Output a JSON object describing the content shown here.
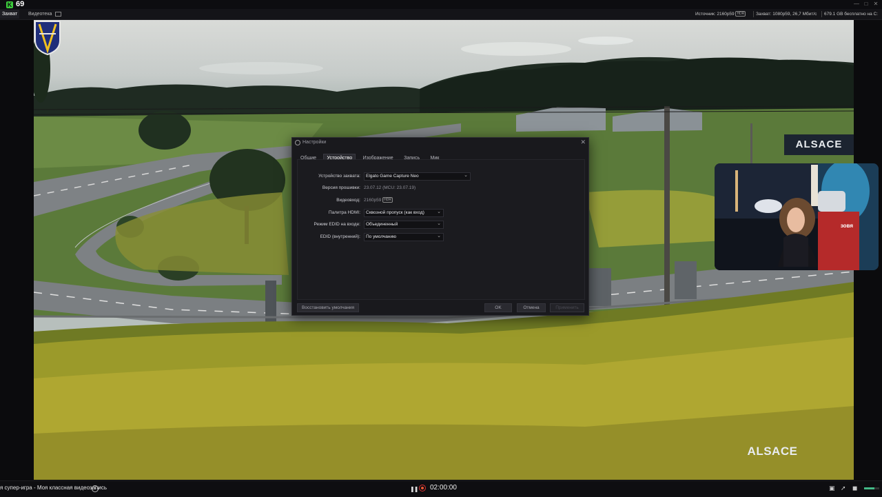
{
  "app": {
    "logo_letter": "K",
    "fps": "69"
  },
  "tabs": [
    {
      "label": "Захват"
    },
    {
      "label": "Видеотека"
    }
  ],
  "status": {
    "source": "Источник: 2160p59",
    "source_badge": "HDR",
    "capture": "Захват: 1080p59, 26,7 Мбит/с",
    "free": "679.1 GB бесплатно на C:"
  },
  "scene": {
    "sign_text": "ALSACE",
    "crest_text": "ALSACE"
  },
  "webcam": {
    "overlay_text": "зовя"
  },
  "dialog": {
    "title": "Настройки",
    "tabs": [
      {
        "label": "Общие",
        "active": false
      },
      {
        "label": "Устройство",
        "active": true
      },
      {
        "label": "Изображение",
        "active": false
      },
      {
        "label": "Запись",
        "active": false
      },
      {
        "label": "Мик",
        "active": false
      }
    ],
    "fields": {
      "device_label": "Устройство захвата:",
      "device_value": "Elgato Game Capture Neo",
      "firmware_label": "Версия прошивки:",
      "firmware_value": "23.07.12 (MCU: 23.07.19)",
      "video_in_label": "Видеовход:",
      "video_in_value": "2160p59",
      "video_in_badge": "HDR",
      "hdmi_label": "Палитра HDMI:",
      "hdmi_value": "Сквозной пропуск (как вход)",
      "edid_mode_label": "Режим EDID на входе:",
      "edid_mode_value": "Объединенный",
      "edid_internal_label": "EDID (внутренний):",
      "edid_internal_value": "По умолчанию"
    },
    "buttons": {
      "restore": "Восстановить умолчания",
      "ok": "OK",
      "cancel": "Отмена",
      "apply": "Применить"
    }
  },
  "bottom": {
    "title": "я супер-игра - Моя классная видеозапись",
    "timer": "02:00:00",
    "audio_level": 0.7
  }
}
